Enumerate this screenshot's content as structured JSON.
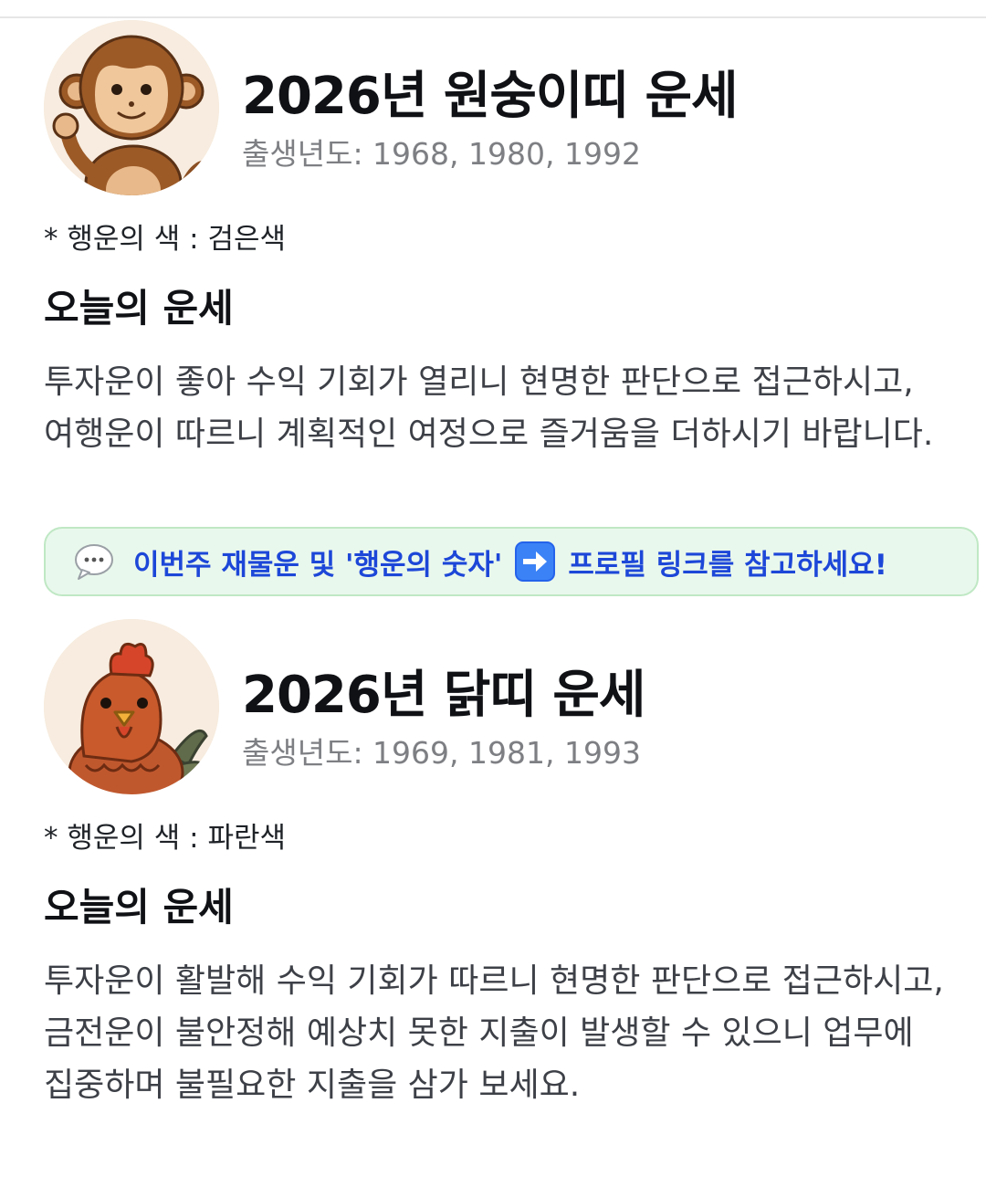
{
  "signs": [
    {
      "icon": "monkey-icon",
      "title": "2026년 원숭이띠 운세",
      "birth_years": "출생년도: 1968, 1980, 1992",
      "lucky_color": "* 행운의 색 : 검은색",
      "section_title": "오늘의 운세",
      "fortune": "투자운이 좋아 수익 기회가 열리니 현명한 판단으로 접근하시고, 여행운이 따르니 계획적인 여정으로 즐거움을 더하시기 바랍니다."
    },
    {
      "icon": "rooster-icon",
      "title": "2026년 닭띠 운세",
      "birth_years": "출생년도: 1969, 1981, 1993",
      "lucky_color": "* 행운의 색 : 파란색",
      "section_title": "오늘의 운세",
      "fortune": "투자운이 활발해 수익 기회가 따르니 현명한 판단으로 접근하시고, 금전운이 불안정해 예상치 못한 지출이 발생할 수 있으니 업무에 집중하며 불필요한 지출을 삼가 보세요."
    }
  ],
  "promo": {
    "text_before": "이번주 재물운 및 '행운의 숫자'",
    "text_after": "프로필 링크를 참고하세요!",
    "icon_left": "speech-bubble-icon",
    "icon_middle": "right-arrow-icon",
    "text_color": "#1d47d8",
    "background": "#e9f8ec",
    "border": "#bfe8c4"
  }
}
